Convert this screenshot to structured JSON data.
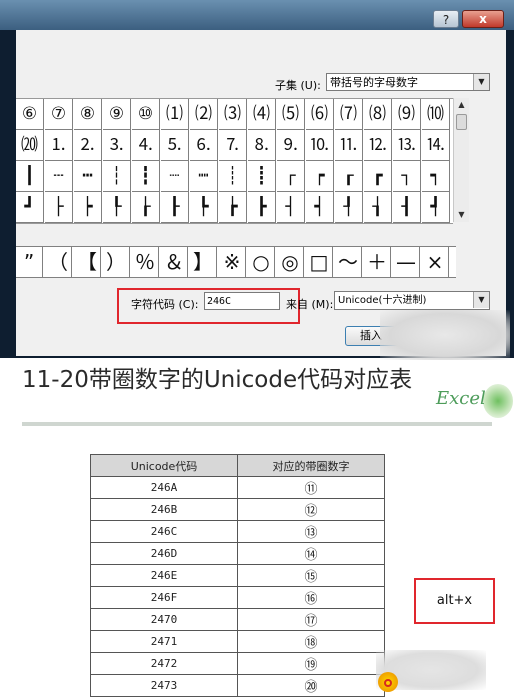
{
  "dialog": {
    "help_label": "?",
    "close_label": "x",
    "subset_label": "子集 (U):",
    "subset_value": "带括号的字母数字",
    "grid_rows": [
      [
        "⑥",
        "⑦",
        "⑧",
        "⑨",
        "⑩",
        "⑴",
        "⑵",
        "⑶",
        "⑷",
        "⑸",
        "⑹",
        "⑺",
        "⑻",
        "⑼",
        "⑽"
      ],
      [
        "⒇",
        "⒈",
        "⒉",
        "⒊",
        "⒋",
        "⒌",
        "⒍",
        "⒎",
        "⒏",
        "⒐",
        "⒑",
        "⒒",
        "⒓",
        "⒔",
        "⒕"
      ],
      [
        "┃",
        "┄",
        "┅",
        "┆",
        "┇",
        "┈",
        "┉",
        "┊",
        "┋",
        "┌",
        "┍",
        "┎",
        "┏",
        "┐",
        "┑"
      ],
      [
        "┛",
        "├",
        "┝",
        "┞",
        "┟",
        "┠",
        "┡",
        "┢",
        "┣",
        "┤",
        "┥",
        "┦",
        "┧",
        "┨",
        "┩"
      ]
    ],
    "recent_chars": [
      "”",
      "（",
      "【",
      "）",
      "％",
      "＆",
      "】",
      "※",
      "○",
      "◎",
      "□",
      "～",
      "＋",
      "—",
      "×"
    ],
    "char_code_label": "字符代码 (C):",
    "char_code_value": "246C",
    "from_label": "来自 (M):",
    "from_value": "Unicode(十六进制)",
    "insert_label": "插入"
  },
  "heading": "11-20带圈数字的Unicode代码对应表",
  "watermark": "Excel",
  "table": {
    "headers": [
      "Unicode代码",
      "对应的带圈数字"
    ],
    "rows": [
      [
        "246A",
        "⑪"
      ],
      [
        "246B",
        "⑫"
      ],
      [
        "246C",
        "⑬"
      ],
      [
        "246D",
        "⑭"
      ],
      [
        "246E",
        "⑮"
      ],
      [
        "246F",
        "⑯"
      ],
      [
        "2470",
        "⑰"
      ],
      [
        "2471",
        "⑱"
      ],
      [
        "2472",
        "⑲"
      ],
      [
        "2473",
        "⑳"
      ]
    ]
  },
  "hotkey_note": "alt+x"
}
